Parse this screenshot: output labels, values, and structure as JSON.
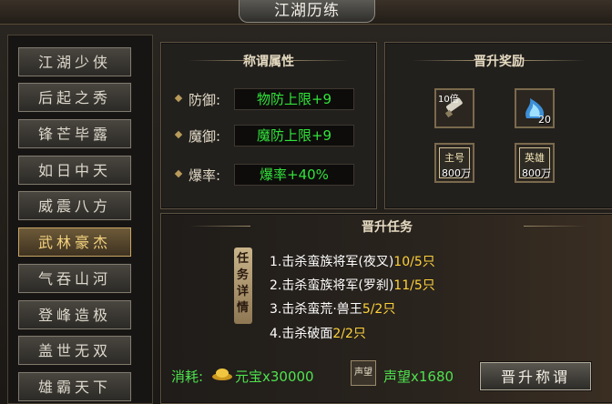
{
  "window": {
    "title": "江湖历练"
  },
  "sidebar": {
    "items": [
      {
        "label": "江湖少侠",
        "active": false
      },
      {
        "label": "后起之秀",
        "active": false
      },
      {
        "label": "锋芒毕露",
        "active": false
      },
      {
        "label": "如日中天",
        "active": false
      },
      {
        "label": "威震八方",
        "active": false
      },
      {
        "label": "武林豪杰",
        "active": true
      },
      {
        "label": "气吞山河",
        "active": false
      },
      {
        "label": "登峰造极",
        "active": false
      },
      {
        "label": "盖世无双",
        "active": false
      },
      {
        "label": "雄霸天下",
        "active": false
      }
    ]
  },
  "attributes": {
    "heading": "称谓属性",
    "rows": [
      {
        "label": "防御:",
        "value": "物防上限+9"
      },
      {
        "label": "魔御:",
        "value": "魔防上限+9"
      },
      {
        "label": "爆率:",
        "value": "爆率+40%"
      }
    ]
  },
  "rewards": {
    "heading": "晋升奖励",
    "items": [
      {
        "icon": "scroll-icon",
        "tag": "10倍",
        "count": ""
      },
      {
        "icon": "blue-flame-icon",
        "tag": "",
        "count": "20"
      },
      {
        "icon": "token-icon",
        "tag": "主号",
        "count": "800万"
      },
      {
        "icon": "token-icon",
        "tag": "英雄",
        "count": "800万"
      }
    ]
  },
  "quest": {
    "heading": "晋升任务",
    "banner": "任务详情",
    "lines": [
      {
        "text": "1.击杀蛮族将军(夜叉)",
        "progress": "10/5只"
      },
      {
        "text": "2.击杀蛮族将军(罗刹)",
        "progress": "11/5只"
      },
      {
        "text": "3.击杀蛮荒·兽王",
        "progress": "5/2只"
      },
      {
        "text": "4.击杀破面",
        "progress": "2/2只"
      }
    ]
  },
  "cost": {
    "label": "消耗:",
    "gold": "元宝x30000",
    "rep_badge": "声望",
    "rep": "声望x1680"
  },
  "action": {
    "promote_label": "晋升称谓"
  },
  "colors": {
    "green": "#32e23a",
    "yellow": "#ffd23a",
    "gold": "#f4d27e"
  }
}
